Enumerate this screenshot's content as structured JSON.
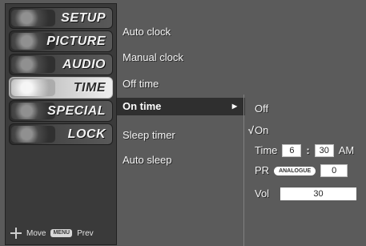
{
  "categories": [
    {
      "label": "SETUP",
      "icon": "setup-icon",
      "active": false
    },
    {
      "label": "PICTURE",
      "icon": "picture-icon",
      "active": false
    },
    {
      "label": "AUDIO",
      "icon": "audio-icon",
      "active": false
    },
    {
      "label": "TIME",
      "icon": "time-icon",
      "active": true
    },
    {
      "label": "SPECIAL",
      "icon": "special-icon",
      "active": false
    },
    {
      "label": "LOCK",
      "icon": "lock-icon",
      "active": false
    }
  ],
  "hint": {
    "move": "Move",
    "menu_key": "MENU",
    "prev": "Prev"
  },
  "submenu": [
    {
      "label": "Auto clock",
      "selected": false
    },
    {
      "label": "Manual clock",
      "selected": false
    },
    {
      "label": "Off time",
      "selected": false
    },
    {
      "label": "On time",
      "selected": true,
      "arrow": "▶"
    },
    {
      "label": "Sleep timer",
      "selected": false
    },
    {
      "label": "Auto sleep",
      "selected": false
    }
  ],
  "on_time": {
    "off_label": "Off",
    "on_label": "On",
    "checked": "On",
    "check_mark": "√",
    "time_label": "Time",
    "hour": "6",
    "colon": ":",
    "minute": "30",
    "ampm": "AM",
    "pr_label": "PR",
    "pr_source": "ANALOGUE",
    "pr_value": "0",
    "vol_label": "Vol",
    "vol_value": "30"
  },
  "colors": {
    "background": "#5b5b5b",
    "highlight": "#2f2f2f",
    "active_category": "#d9d9d9"
  }
}
